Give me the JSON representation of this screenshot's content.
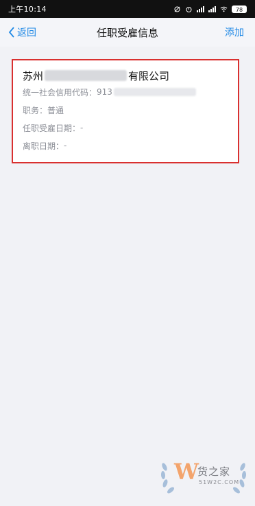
{
  "status_bar": {
    "time": "上午10:14",
    "battery": "78"
  },
  "header": {
    "back_label": "返回",
    "title": "任职受雇信息",
    "add_label": "添加"
  },
  "card": {
    "company_prefix": "苏州",
    "company_suffix": "有限公司",
    "credit_code_label": "统一社会信用代码：",
    "credit_code_prefix": "913",
    "position_label": "职务：",
    "position_value": "普通",
    "employment_date_label": "任职受雇日期：",
    "employment_date_value": "-",
    "leave_date_label": "离职日期：",
    "leave_date_value": "-"
  },
  "watermark": {
    "letter": "W",
    "name": "货之家",
    "site": "51W2C.COM"
  },
  "colors": {
    "accent": "#1e88e5",
    "highlight_border": "#d9302f",
    "watermark_orange": "#f3a46c"
  }
}
